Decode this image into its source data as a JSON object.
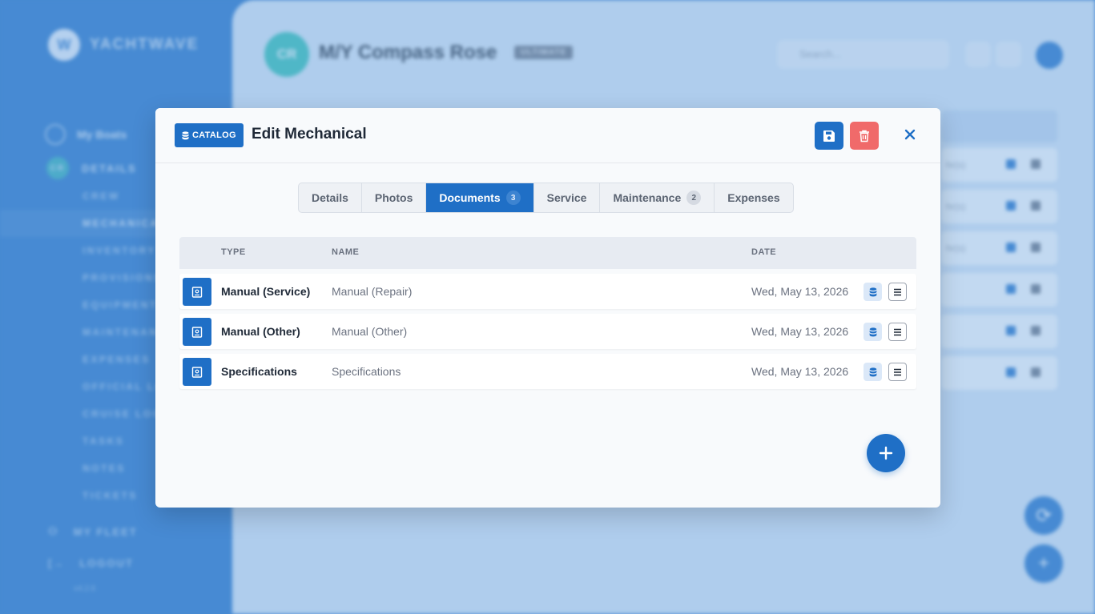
{
  "app": {
    "brand": "YACHTWAVE",
    "logo_glyph": "W",
    "version": "v4.2.6"
  },
  "sidebar": {
    "my_boats": "My Boats",
    "details_avatar": "CR",
    "details": "DETAILS",
    "items": [
      {
        "label": "CREW"
      },
      {
        "label": "MECHANICAL"
      },
      {
        "label": "INVENTORY"
      },
      {
        "label": "PROVISIONS"
      },
      {
        "label": "EQUIPMENT"
      },
      {
        "label": "MAINTENANCE"
      },
      {
        "label": "EXPENSES"
      },
      {
        "label": "OFFICIAL LOGS"
      },
      {
        "label": "CRUISE LOGS"
      },
      {
        "label": "TASKS"
      },
      {
        "label": "NOTES"
      },
      {
        "label": "TICKETS"
      }
    ],
    "active_item": "MECHANICAL",
    "my_fleet": "MY FLEET",
    "logout": "LOGOUT"
  },
  "background": {
    "boat_initials": "CR",
    "boat_name": "M/Y Compass Rose",
    "boat_badge": "ULTIMATE",
    "search_placeholder": "Search...",
    "row_hints": [
      "hr(s)",
      "hr(s)",
      "hr(s)",
      "",
      "",
      ""
    ]
  },
  "modal": {
    "badge": "CATALOG",
    "title": "Edit Mechanical",
    "tabs": [
      {
        "label": "Details",
        "count": ""
      },
      {
        "label": "Photos",
        "count": ""
      },
      {
        "label": "Documents",
        "count": "3"
      },
      {
        "label": "Service",
        "count": ""
      },
      {
        "label": "Maintenance",
        "count": "2"
      },
      {
        "label": "Expenses",
        "count": ""
      }
    ],
    "active_tab": "Documents",
    "table": {
      "headers": {
        "type": "TYPE",
        "name": "NAME",
        "date": "DATE"
      },
      "rows": [
        {
          "type": "Manual (Service)",
          "name": "Manual (Repair)",
          "date": "Wed, May 13, 2026"
        },
        {
          "type": "Manual (Other)",
          "name": "Manual (Other)",
          "date": "Wed, May 13, 2026"
        },
        {
          "type": "Specifications",
          "name": "Specifications",
          "date": "Wed, May 13, 2026"
        }
      ]
    }
  },
  "colors": {
    "primary": "#1f6fc6",
    "danger": "#f06a6a",
    "teal_avatar": "#2ec1b3"
  }
}
